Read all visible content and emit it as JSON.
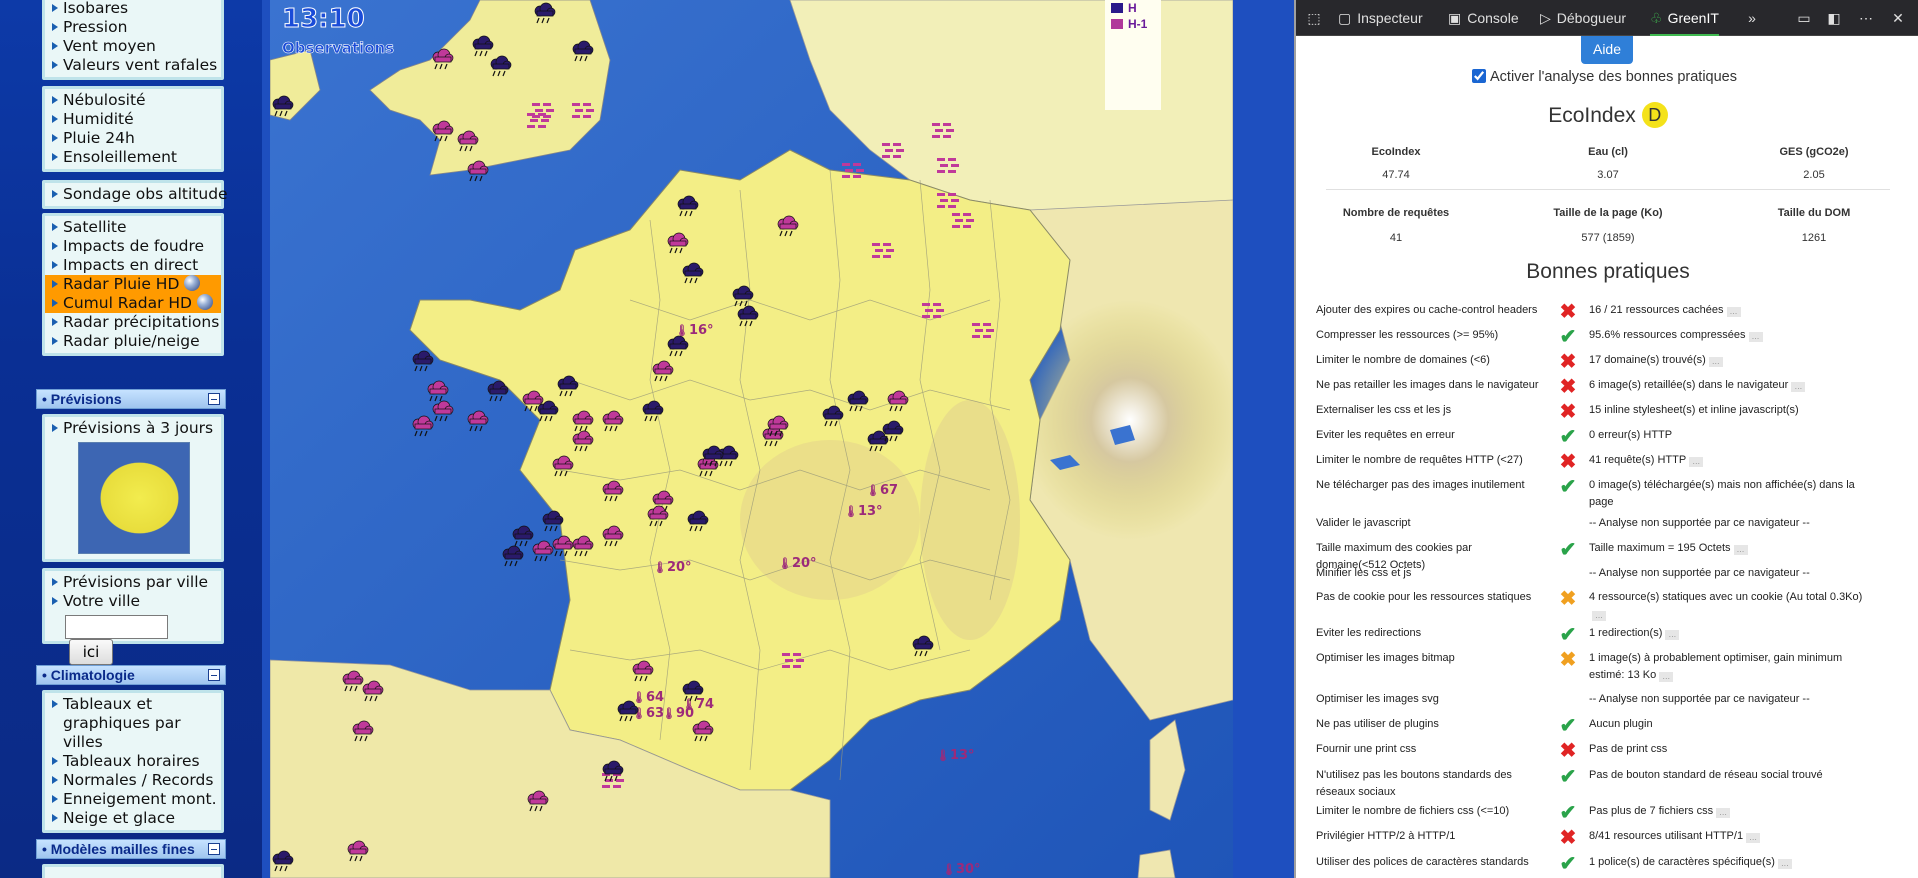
{
  "sidebar": {
    "group1": [
      "Isobares",
      "Pression",
      "Vent moyen",
      "Valeurs vent rafales"
    ],
    "group2": [
      "Nébulosité",
      "Humidité",
      "Pluie 24h",
      "Ensoleillement"
    ],
    "group3": [
      "Sondage obs altitude"
    ],
    "group4": [
      "Satellite",
      "Impacts de foudre",
      "Impacts en direct",
      "Radar Pluie HD",
      "Cumul Radar HD",
      "Radar précipitations",
      "Radar pluie/neige"
    ],
    "previsions_title": "• Prévisions",
    "previsions_item": "Prévisions à 3 jours",
    "ville_items": [
      "Prévisions par ville",
      "Votre ville"
    ],
    "ville_input_value": "",
    "ville_button": "ici",
    "climatologie_title": "• Climatologie",
    "climatologie_items": [
      "Tableaux et graphiques par villes",
      "Tableaux horaires",
      "Normales / Records",
      "Enneigement mont.",
      "Neige et glace"
    ],
    "modeles_title": "• Modèles mailles fines"
  },
  "map": {
    "time": "13:10",
    "subtitle": "Observations",
    "legend": [
      {
        "label": "H",
        "color": "#2a1a8a"
      },
      {
        "label": "H-1",
        "color": "#b0399a"
      }
    ],
    "temperatures": [
      "16°",
      "20°",
      "20°",
      "13°",
      "64",
      "63",
      "74",
      "90",
      "67",
      "30°",
      "13°"
    ]
  },
  "devtools": {
    "tabs": [
      "Inspecteur",
      "Console",
      "Débogueur",
      "GreenIT"
    ],
    "active_tab": "GreenIT"
  },
  "greenit": {
    "aide": "Aide",
    "activer_label": "Activer l'analyse des bonnes pratiques",
    "activer_checked": true,
    "ecoindex_title": "EcoIndex",
    "grade": "D",
    "grade_color": "#f4e21a",
    "stats_row1": [
      {
        "label": "EcoIndex",
        "value": "47.74"
      },
      {
        "label": "Eau (cl)",
        "value": "3.07"
      },
      {
        "label": "GES (gCO2e)",
        "value": "2.05"
      }
    ],
    "stats_row2": [
      {
        "label": "Nombre de requêtes",
        "value": "41"
      },
      {
        "label": "Taille de la page (Ko)",
        "value": "577 (1859)"
      },
      {
        "label": "Taille du DOM",
        "value": "1261"
      }
    ],
    "bonnes_pratiques_title": "Bonnes pratiques",
    "rules": [
      {
        "name": "Ajouter des expires ou cache-control headers",
        "status": "ko",
        "desc": "16 / 21 ressources cachées"
      },
      {
        "name": "Compresser les ressources (>= 95%)",
        "status": "ok",
        "desc": "95.6% ressources compressées"
      },
      {
        "name": "Limiter le nombre de domaines (<6)",
        "status": "ko",
        "desc": "17 domaine(s) trouvé(s)"
      },
      {
        "name": "Ne pas retailler les images dans le navigateur",
        "status": "ko",
        "desc": "6 image(s) retaillée(s) dans le navigateur"
      },
      {
        "name": "Externaliser les css et les js",
        "status": "ko",
        "desc": "15 inline stylesheet(s) et inline javascript(s)"
      },
      {
        "name": "Eviter les requêtes en erreur",
        "status": "ok",
        "desc": "0 erreur(s) HTTP"
      },
      {
        "name": "Limiter le nombre de requêtes HTTP (<27)",
        "status": "ko",
        "desc": "41 requête(s) HTTP"
      },
      {
        "name": "Ne télécharger pas des images inutilement",
        "status": "ok",
        "desc": "0 image(s) téléchargée(s) mais non affichée(s) dans la page"
      },
      {
        "name": "Valider le javascript",
        "status": "none",
        "desc": "-- Analyse non supportée par ce navigateur --"
      },
      {
        "name": "Taille maximum des cookies par domaine(<512 Octets)",
        "status": "ok",
        "desc": "Taille maximum = 195 Octets"
      },
      {
        "name": "Minifier les css et js",
        "status": "none",
        "desc": "-- Analyse non supportée par ce navigateur --"
      },
      {
        "name": "Pas de cookie pour les ressources statiques",
        "status": "warn",
        "desc": "4 ressource(s) statiques avec un cookie (Au total 0.3Ko)"
      },
      {
        "name": "Eviter les redirections",
        "status": "ok",
        "desc": "1 redirection(s)"
      },
      {
        "name": "Optimiser les images bitmap",
        "status": "warn",
        "desc": "1 image(s) à probablement optimiser, gain minimum estimé: 13 Ko"
      },
      {
        "name": "Optimiser les images svg",
        "status": "none",
        "desc": "-- Analyse non supportée par ce navigateur --"
      },
      {
        "name": "Ne pas utiliser de plugins",
        "status": "ok",
        "desc": "Aucun plugin"
      },
      {
        "name": "Fournir une print css",
        "status": "ko",
        "desc": "Pas de print css"
      },
      {
        "name": "N'utilisez pas les boutons standards des réseaux sociaux",
        "status": "ok",
        "desc": "Pas de bouton standard de réseau social trouvé"
      },
      {
        "name": "Limiter le nombre de fichiers css (<=10)",
        "status": "ok",
        "desc": "Pas plus de 7 fichiers css"
      },
      {
        "name": "Privilégier HTTP/2 à HTTP/1",
        "status": "ko",
        "desc": "8/41 resources utilisant HTTP/1"
      },
      {
        "name": "Utiliser des polices de caractères standards",
        "status": "ok",
        "desc": "1 police(s) de caractères spécifique(s)"
      }
    ],
    "status_icons": {
      "ok": "✔",
      "ko": "✖",
      "warn": "✖",
      "none": ""
    }
  }
}
